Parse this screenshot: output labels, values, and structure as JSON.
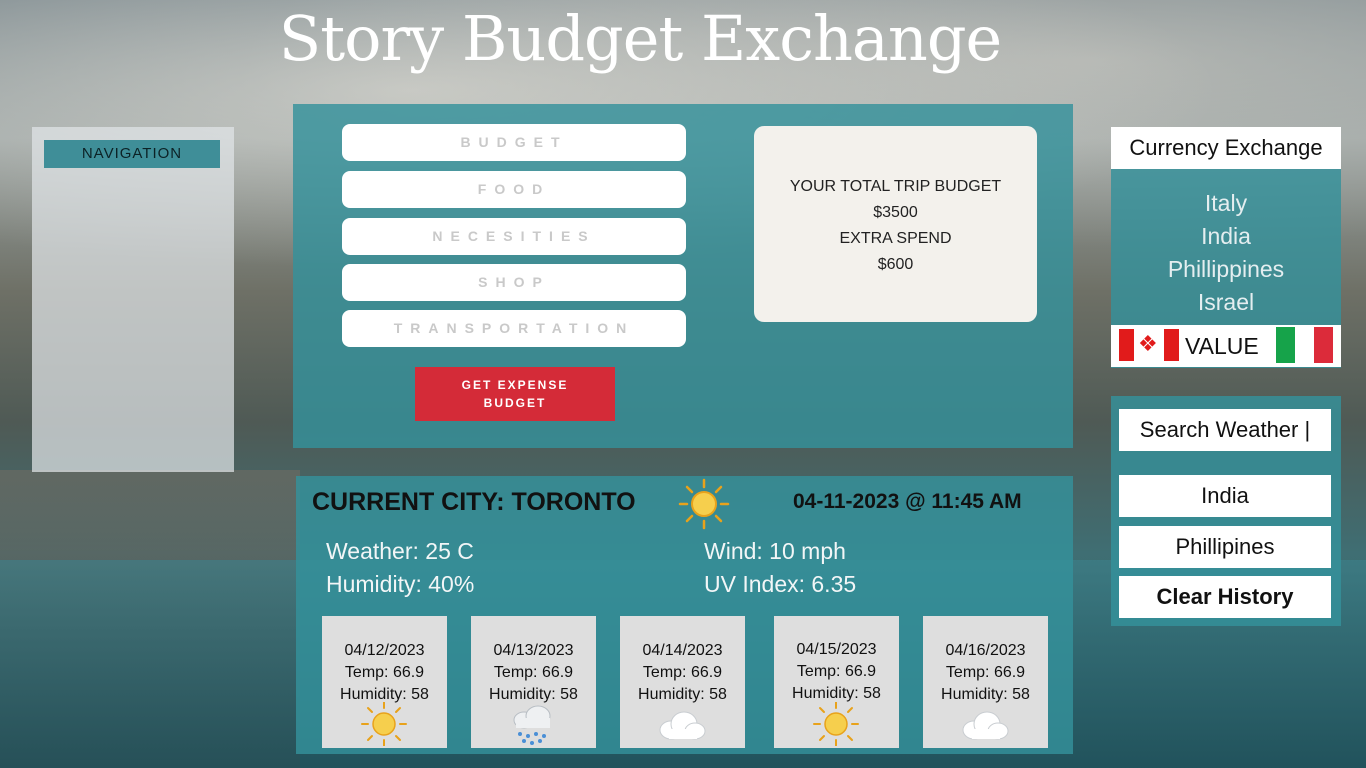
{
  "app": {
    "title": "Story Budget Exchange"
  },
  "navigation": {
    "label": "NAVIGATION"
  },
  "budget": {
    "categories": [
      "BUDGET",
      "FOOD",
      "NECESITIES",
      "SHOP",
      "TRANSPORTATION"
    ],
    "expense_button_label": "GET EXPENSE BUDGET",
    "total_label": "YOUR TOTAL TRIP BUDGET",
    "total_value": "$3500",
    "extra_label": "EXTRA SPEND",
    "extra_value": "$600"
  },
  "currency": {
    "title": "Currency Exchange",
    "countries": [
      "Italy",
      "India",
      "Phillippines",
      "Israel"
    ],
    "value_label": "VALUE",
    "from_flag": "canada-flag",
    "to_flag": "italy-flag"
  },
  "weather_search": {
    "search_text": "Search Weather |",
    "history": [
      "India",
      "Phillipines"
    ],
    "clear_label": "Clear History"
  },
  "current": {
    "city_label": "CURRENT CITY: TORONTO",
    "datetime": "04-11-2023 @ 11:45 AM",
    "weather": "Weather: 25 C",
    "humidity": "Humidity: 40%",
    "wind": "Wind: 10 mph",
    "uv": "UV Index: 6.35",
    "icon": "sun-icon"
  },
  "forecast": [
    {
      "date": "04/12/2023",
      "temp": "Temp: 66.9",
      "humidity": "Humidity: 58",
      "icon": "sun-icon"
    },
    {
      "date": "04/13/2023",
      "temp": "Temp: 66.9",
      "humidity": "Humidity: 58",
      "icon": "rain-cloud-icon"
    },
    {
      "date": "04/14/2023",
      "temp": "Temp: 66.9",
      "humidity": "Humidity: 58",
      "icon": "cloud-icon"
    },
    {
      "date": "04/15/2023",
      "temp": "Temp: 66.9",
      "humidity": "Humidity: 58",
      "icon": "sun-icon"
    },
    {
      "date": "04/16/2023",
      "temp": "Temp: 66.9",
      "humidity": "Humidity: 58",
      "icon": "cloud-icon"
    }
  ],
  "colors": {
    "panel_teal": "#3491a0",
    "accent_red": "#d42b38",
    "nav_label_bg": "#3f8e98"
  }
}
